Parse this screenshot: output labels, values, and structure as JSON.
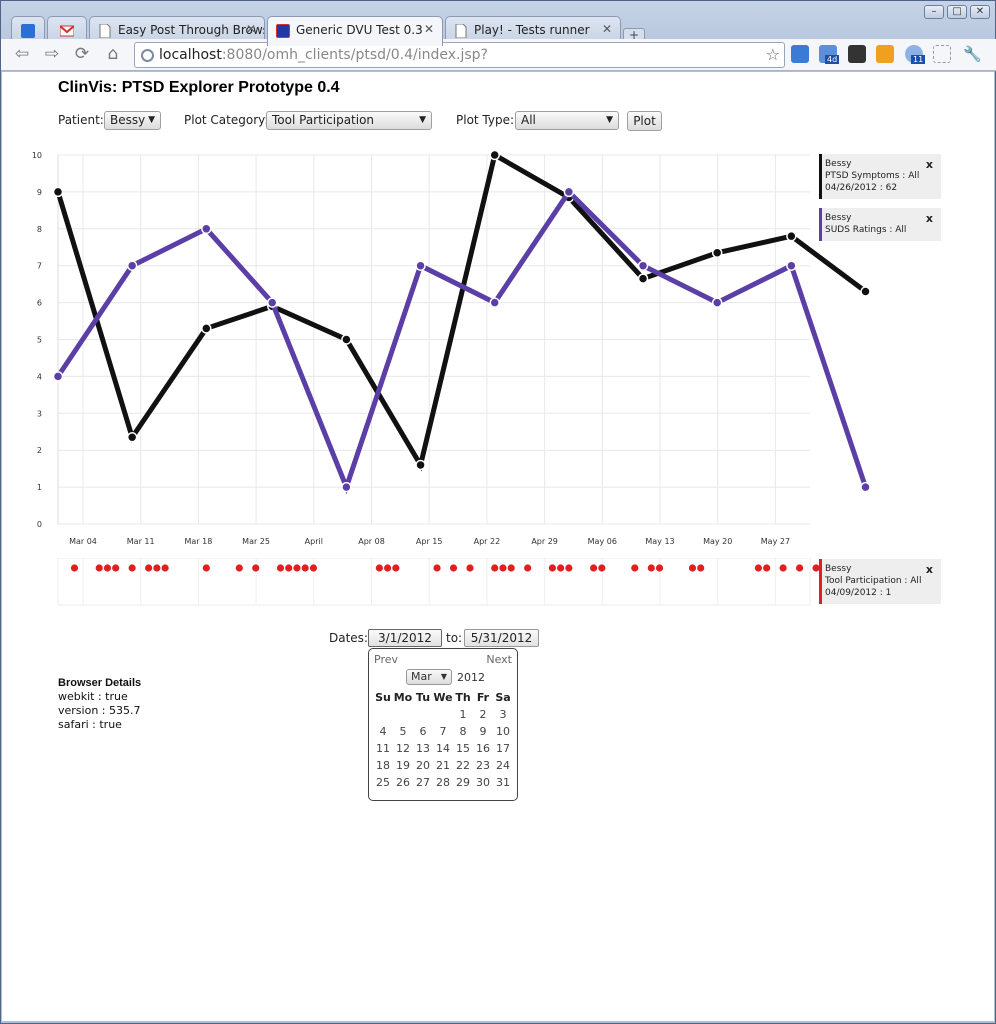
{
  "browser": {
    "tabs": [
      {
        "label": "",
        "icon": "calendar-icon",
        "active": false
      },
      {
        "label": "",
        "icon": "gmail-icon",
        "active": false
      },
      {
        "label": "Easy Post Through Browse",
        "icon": "document-icon",
        "active": false
      },
      {
        "label": "Generic DVU Test 0.3",
        "icon": "app-icon",
        "active": true
      },
      {
        "label": "Play! - Tests runner",
        "icon": "document-icon",
        "active": false
      }
    ],
    "url_host": "localhost",
    "url_rest": ":8080/omh_clients/ptsd/0.4/index.jsp?",
    "badges": {
      "ext_a": "4d",
      "ext_b": "11"
    }
  },
  "app": {
    "title": "ClinVis: PTSD Explorer Prototype 0.4"
  },
  "controls": {
    "patient_label": "Patient:",
    "patient_value": "Bessy",
    "category_label": "Plot Category:",
    "category_value": "Tool Participation",
    "type_label": "Plot Type:",
    "type_value": "All",
    "plot_button": "Plot"
  },
  "legend": [
    {
      "name": "Bessy",
      "line2": "PTSD Symptoms : All",
      "line3": "04/26/2012 : 62",
      "color": "#111111",
      "close": "x"
    },
    {
      "name": "Bessy",
      "line2": "SUDS Ratings : All",
      "line3": "",
      "color": "#5b3fa6",
      "close": "x"
    },
    {
      "name": "Bessy",
      "line2": "Tool Participation : All",
      "line3": "04/09/2012 : 1",
      "color": "#e02020",
      "close": "x"
    }
  ],
  "chart_data": {
    "type": "line",
    "x_tick_labels": [
      "Mar 04",
      "Mar 11",
      "Mar 18",
      "Mar 25",
      "April",
      "Apr 08",
      "Apr 15",
      "Apr 22",
      "Apr 29",
      "May 06",
      "May 13",
      "May 20",
      "May 27"
    ],
    "y_tick_labels": [
      "0",
      "1",
      "2",
      "3",
      "4",
      "5",
      "6",
      "7",
      "8",
      "9",
      "10"
    ],
    "ylim": [
      0,
      10
    ],
    "xlim": [
      "2012-03-01",
      "2012-05-31"
    ],
    "series": [
      {
        "name": "PTSD Symptoms : All",
        "color": "#111111",
        "points": [
          [
            "2012-03-01",
            9.0
          ],
          [
            "2012-03-10",
            2.35
          ],
          [
            "2012-03-19",
            5.3
          ],
          [
            "2012-03-27",
            5.9
          ],
          [
            "2012-04-05",
            5.0
          ],
          [
            "2012-04-14",
            1.6
          ],
          [
            "2012-04-23",
            10.0
          ],
          [
            "2012-05-02",
            8.85
          ],
          [
            "2012-05-11",
            6.65
          ],
          [
            "2012-05-20",
            7.35
          ],
          [
            "2012-05-29",
            7.8
          ],
          [
            "2012-06-07",
            6.3
          ]
        ]
      },
      {
        "name": "SUDS Ratings : All",
        "color": "#5b3fa6",
        "points": [
          [
            "2012-03-01",
            4.0
          ],
          [
            "2012-03-10",
            7.0
          ],
          [
            "2012-03-19",
            8.0
          ],
          [
            "2012-03-27",
            6.0
          ],
          [
            "2012-04-05",
            1.0
          ],
          [
            "2012-04-14",
            7.0
          ],
          [
            "2012-04-23",
            6.0
          ],
          [
            "2012-05-02",
            9.0
          ],
          [
            "2012-05-11",
            7.0
          ],
          [
            "2012-05-20",
            6.0
          ],
          [
            "2012-05-29",
            7.0
          ],
          [
            "2012-06-07",
            1.0
          ]
        ]
      }
    ],
    "events": {
      "name": "Tool Participation : All",
      "color": "#e02020",
      "dates": [
        "2012-03-03",
        "2012-03-06",
        "2012-03-07",
        "2012-03-08",
        "2012-03-10",
        "2012-03-12",
        "2012-03-13",
        "2012-03-14",
        "2012-03-19",
        "2012-03-23",
        "2012-03-25",
        "2012-03-28",
        "2012-03-29",
        "2012-03-30",
        "2012-03-31",
        "2012-04-01",
        "2012-04-09",
        "2012-04-10",
        "2012-04-11",
        "2012-04-16",
        "2012-04-18",
        "2012-04-20",
        "2012-04-23",
        "2012-04-24",
        "2012-04-25",
        "2012-04-27",
        "2012-04-30",
        "2012-05-01",
        "2012-05-02",
        "2012-05-05",
        "2012-05-06",
        "2012-05-10",
        "2012-05-12",
        "2012-05-13",
        "2012-05-17",
        "2012-05-18",
        "2012-05-25",
        "2012-05-26",
        "2012-05-28",
        "2012-05-30",
        "2012-06-01",
        "2012-06-02",
        "2012-06-03",
        "2012-06-04"
      ]
    }
  },
  "dates": {
    "label": "Dates:",
    "from": "3/1/2012",
    "to_label": "to:",
    "to": "5/31/2012"
  },
  "datepicker": {
    "prev": "Prev",
    "next": "Next",
    "month": "Mar",
    "year": "2012",
    "weekdays": [
      "Su",
      "Mo",
      "Tu",
      "We",
      "Th",
      "Fr",
      "Sa"
    ],
    "weeks": [
      [
        "",
        "",
        "",
        "",
        "1",
        "2",
        "3"
      ],
      [
        "4",
        "5",
        "6",
        "7",
        "8",
        "9",
        "10"
      ],
      [
        "11",
        "12",
        "13",
        "14",
        "15",
        "16",
        "17"
      ],
      [
        "18",
        "19",
        "20",
        "21",
        "22",
        "23",
        "24"
      ],
      [
        "25",
        "26",
        "27",
        "28",
        "29",
        "30",
        "31"
      ]
    ]
  },
  "browser_details": {
    "heading": "Browser Details",
    "lines": [
      "webkit : true",
      "version : 535.7",
      "safari : true"
    ]
  }
}
